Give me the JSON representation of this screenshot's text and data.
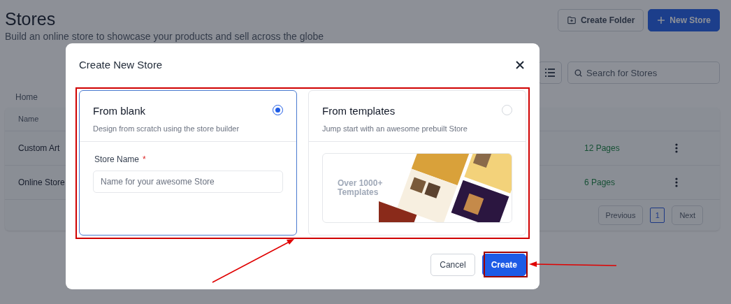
{
  "page": {
    "title": "Stores",
    "subtitle": "Build an online store to showcase your products and sell across the globe",
    "buttons": [
      {
        "label": "Create Folder",
        "kind": "secondary"
      },
      {
        "label": "New Store",
        "kind": "primary"
      }
    ],
    "search": {
      "placeholder": "Search for Stores"
    },
    "breadcrumb": "Home",
    "table": {
      "columns": [
        "Name"
      ],
      "rows": [
        {
          "name": "Custom Art",
          "pages": "12 Pages"
        },
        {
          "name": "Online Store",
          "pages": "6 Pages"
        }
      ]
    },
    "pagination": {
      "previous": "Previous",
      "pages": [
        {
          "label": "1",
          "selected": true
        }
      ],
      "next": "Next"
    }
  },
  "modal": {
    "title": "Create New Store",
    "options": [
      {
        "kind": "blank",
        "title": "From blank",
        "description": "Design from scratch using the store builder",
        "selected": true,
        "field": {
          "label": "Store Name",
          "required_mark": "*",
          "placeholder": "Name for your awesome Store"
        }
      },
      {
        "kind": "templates",
        "title": "From templates",
        "description": "Jump start with an awesome prebuilt Store",
        "selected": false,
        "preview_text": "Over 1000+\nTemplates"
      }
    ],
    "buttons": [
      {
        "label": "Cancel",
        "kind": "secondary"
      },
      {
        "label": "Create",
        "kind": "primary"
      }
    ]
  }
}
